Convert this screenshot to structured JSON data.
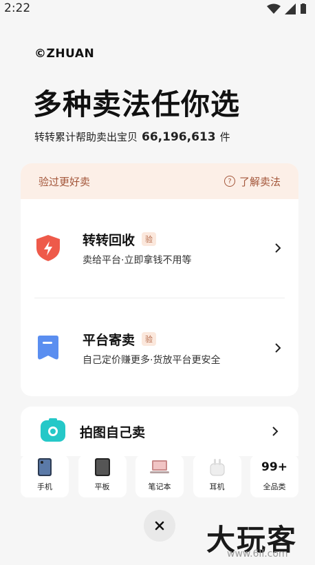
{
  "status": {
    "time": "2:22"
  },
  "brand": "©ZHUAN",
  "headline": "多种卖法任你选",
  "subline": {
    "prefix": "转转累计帮助卖出宝贝",
    "count": "66,196,613",
    "suffix": "件"
  },
  "verified": {
    "title": "验过更好卖",
    "learn_more": "了解卖法",
    "options": [
      {
        "title": "转转回收",
        "tag": "验",
        "desc": "卖给平台·立即拿钱不用等"
      },
      {
        "title": "平台寄卖",
        "tag": "验",
        "desc": "自己定价赚更多·货放平台更安全"
      }
    ]
  },
  "photo_sell": {
    "title": "拍图自己卖"
  },
  "categories": [
    {
      "label": "手机",
      "icon": "phone-icon"
    },
    {
      "label": "平板",
      "icon": "tablet-icon"
    },
    {
      "label": "笔记本",
      "icon": "laptop-icon"
    },
    {
      "label": "耳机",
      "icon": "earphones-icon"
    },
    {
      "label": "全品类",
      "badge": "99+"
    }
  ],
  "watermark": {
    "text": "大玩客",
    "sub": "www.6ll.com"
  },
  "colors": {
    "accent": "#a3563a",
    "header_bg": "#fcefe7",
    "shield": "#ee5a4a",
    "doc": "#5a8ef0",
    "camera": "#25c8c8"
  }
}
